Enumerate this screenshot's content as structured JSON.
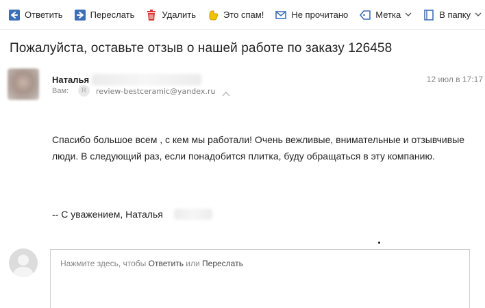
{
  "toolbar": {
    "reply_label": "Ответить",
    "forward_label": "Переслать",
    "delete_label": "Удалить",
    "spam_label": "Это спам!",
    "unread_label": "Не прочитано",
    "label_label": "Метка",
    "folder_label": "В папку",
    "colors": {
      "icon_blue": "#3d6fb6",
      "delete_red": "#d6322f",
      "spam_yellow": "#f2c200"
    }
  },
  "message": {
    "subject": "Пожалуйста, оставьте отзыв о нашей работе по заказу 126458",
    "sender_name": "Наталья",
    "date": "12 июл в 17:17",
    "to_label": "Вам:",
    "to_badge": "R",
    "to_email": "review-bestceramic@yandex.ru",
    "body": "Спасибо большое всем , с кем мы работали! Очень вежливые, внимательные и отзывчивые люди. В следующий раз, если понадобится плитка, буду обращаться в эту компанию.",
    "signature": "-- С уважением, Наталья"
  },
  "reply": {
    "hint_prefix": "Нажмите здесь, чтобы ",
    "reply_link": "Ответить",
    "hint_or": " или ",
    "forward_link": "Переслать"
  }
}
